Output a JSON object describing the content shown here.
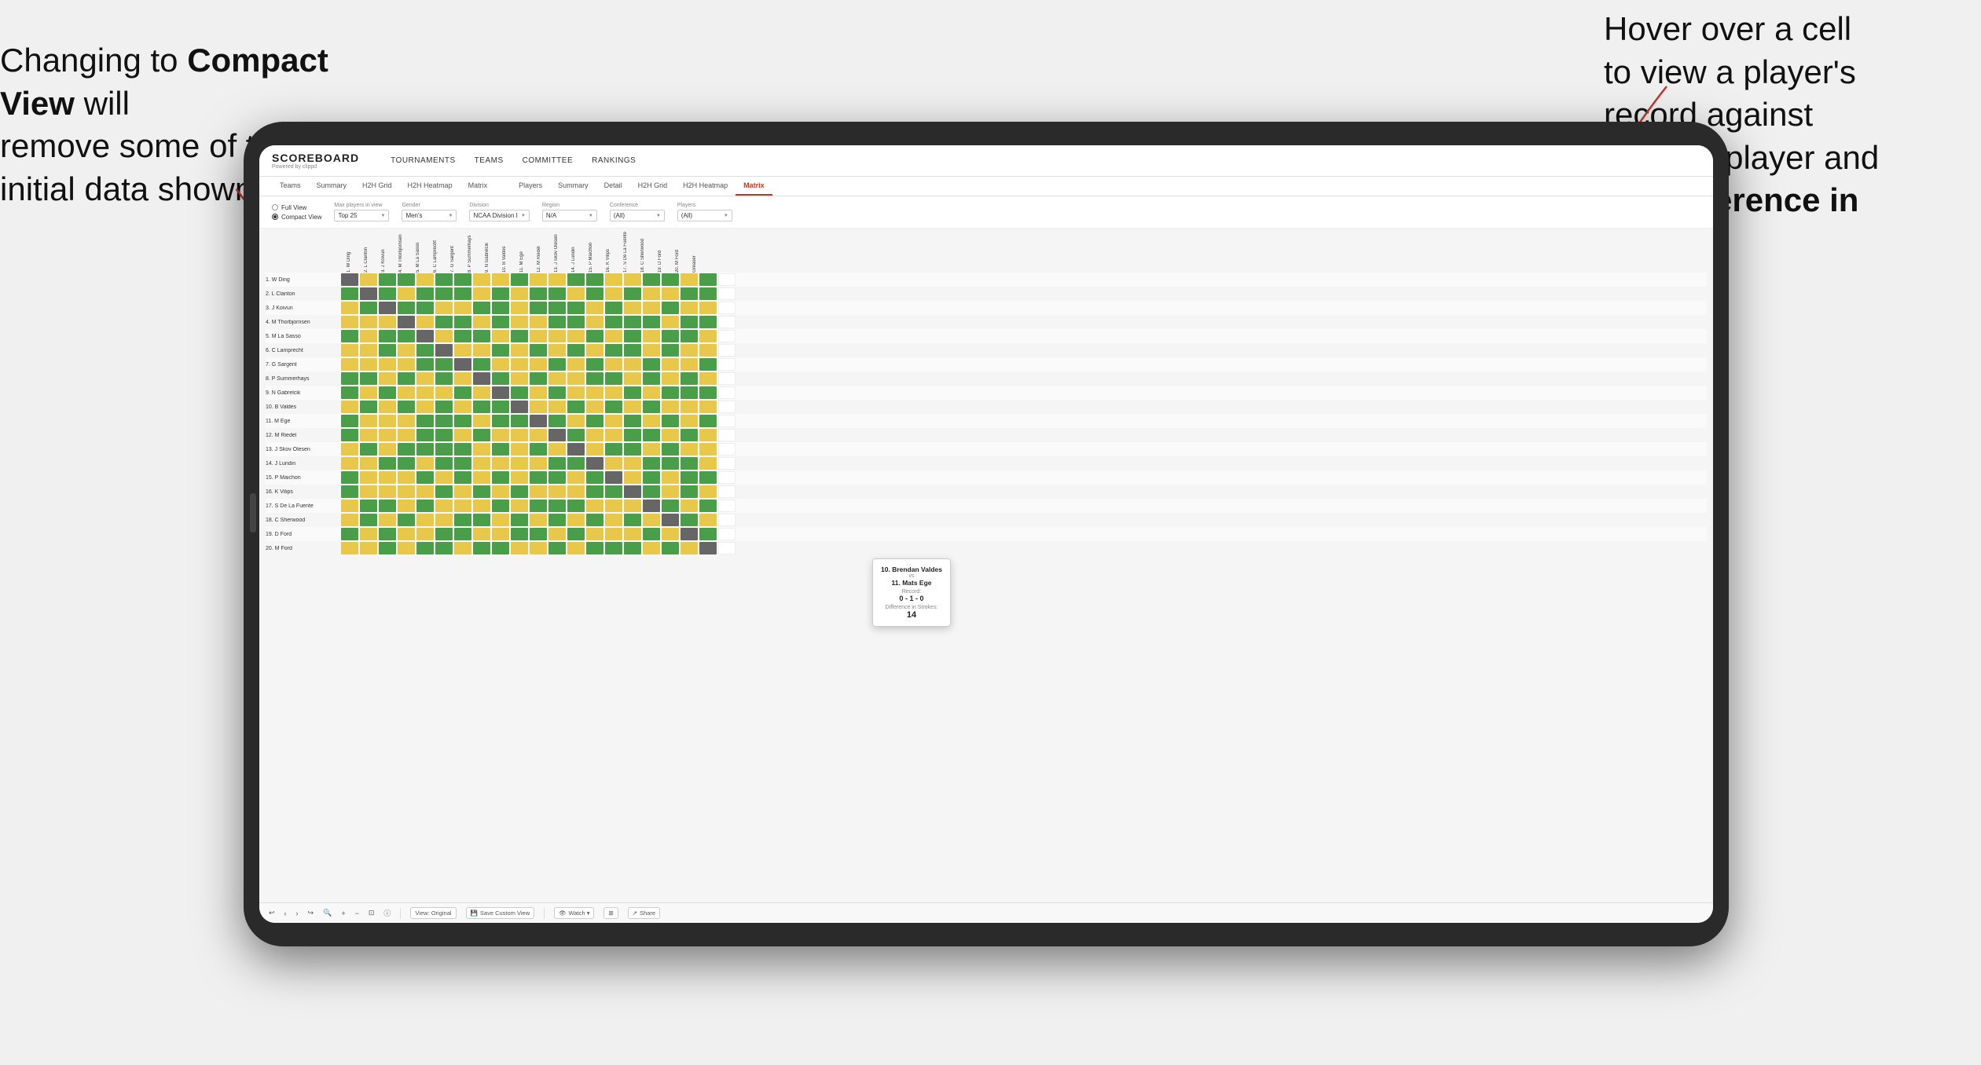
{
  "annotations": {
    "left_text": "Changing to Compact View will remove some of the initial data shown",
    "left_bold": "Compact View",
    "right_text": "Hover over a cell to view a player's record against another player and the Difference in Strokes",
    "right_bold": "Difference in Strokes"
  },
  "app": {
    "logo": "SCOREBOARD",
    "logo_sub": "Powered by clippd",
    "nav": [
      "TOURNAMENTS",
      "TEAMS",
      "COMMITTEE",
      "RANKINGS"
    ]
  },
  "sub_tabs": {
    "group1": [
      "Teams",
      "Summary",
      "H2H Grid",
      "H2H Heatmap",
      "Matrix"
    ],
    "group2_active": "Matrix",
    "group2": [
      "Players",
      "Summary",
      "Detail",
      "H2H Grid",
      "H2H Heatmap",
      "Matrix"
    ]
  },
  "controls": {
    "view_options": [
      "Full View",
      "Compact View"
    ],
    "selected_view": "Compact View",
    "max_players_label": "Max players in view",
    "max_players_value": "Top 25",
    "gender_label": "Gender",
    "gender_value": "Men's",
    "division_label": "Division",
    "division_value": "NCAA Division I",
    "region_label": "Region",
    "region_value": "N/A",
    "conference_label": "Conference",
    "conference_value": "(All)",
    "players_label": "Players",
    "players_value": "(All)"
  },
  "col_headers": [
    "1. W Ding",
    "2. L Clanton",
    "3. J Koivun",
    "4. M Thorbjornsen",
    "5. M La Sasso",
    "6. C Lamprecht",
    "7. G Sargent",
    "8. P Summerhays",
    "9. N Gabrelcik",
    "10. B Valdes",
    "11. M Ege",
    "12. M Riedel",
    "13. J Skov Olesen",
    "14. J Lundin",
    "15. P Maichon",
    "16. K Vilips",
    "17. S De La Fuente",
    "18. C Sherwood",
    "19. D Ford",
    "20. M Ford",
    "Greaser"
  ],
  "row_players": [
    "1. W Ding",
    "2. L Clanton",
    "3. J Koivun",
    "4. M Thorbjornsen",
    "5. M La Sasso",
    "6. C Lamprecht",
    "7. G Sargent",
    "8. P Summerhays",
    "9. N Gabrelcik",
    "10. B Valdes",
    "11. M Ege",
    "12. M Riedel",
    "13. J Skov Olesen",
    "14. J Lundin",
    "15. P Maichon",
    "16. K Vilips",
    "17. S De La Fuente",
    "18. C Sherwood",
    "19. D Ford",
    "20. M Ford"
  ],
  "tooltip": {
    "player1": "10. Brendan Valdes",
    "vs": "vs",
    "player2": "11. Mats Ege",
    "record_label": "Record:",
    "record": "0 - 1 - 0",
    "diff_label": "Difference in Strokes:",
    "diff": "14"
  },
  "toolbar": {
    "view_original": "View: Original",
    "save_custom": "Save Custom View",
    "watch": "Watch ▾",
    "share": "Share"
  }
}
